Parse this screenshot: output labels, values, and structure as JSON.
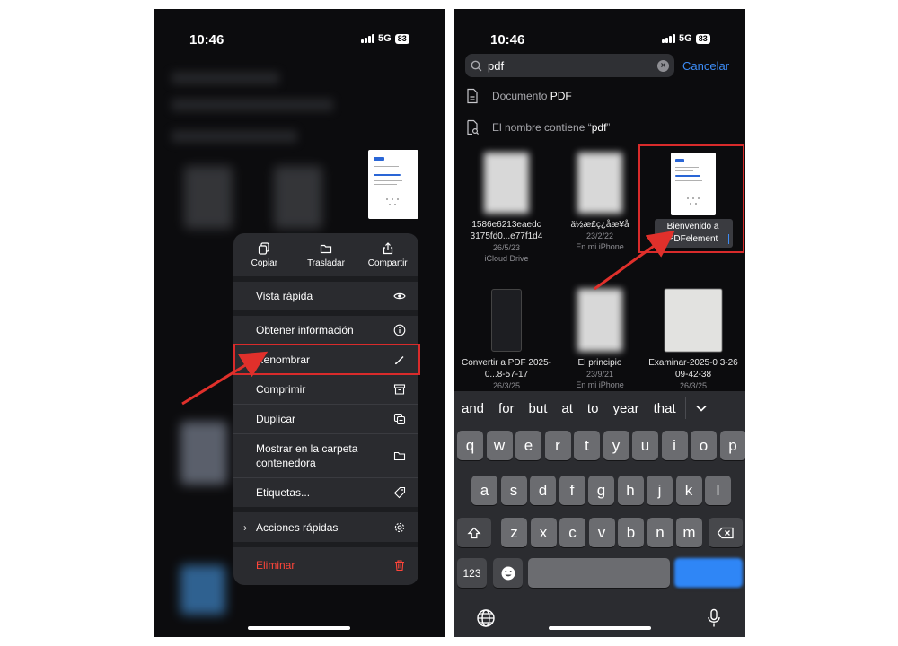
{
  "left_screen": {
    "status": {
      "time": "10:46",
      "network": "5G",
      "battery": "83"
    },
    "quick_actions": [
      {
        "label": "Copiar",
        "icon": "copy-icon"
      },
      {
        "label": "Trasladar",
        "icon": "folder-icon"
      },
      {
        "label": "Compartir",
        "icon": "share-icon"
      }
    ],
    "menu_items": [
      {
        "label": "Vista rápida",
        "icon": "eye-icon"
      },
      {
        "label": "Obtener información",
        "icon": "info-icon"
      },
      {
        "label": "Renombrar",
        "icon": "pencil-icon",
        "highlighted": true
      },
      {
        "label": "Comprimir",
        "icon": "archive-icon"
      },
      {
        "label": "Duplicar",
        "icon": "duplicate-icon"
      },
      {
        "label": "Mostrar en la carpeta contenedora",
        "icon": "folder-icon"
      },
      {
        "label": "Etiquetas...",
        "icon": "tag-icon"
      },
      {
        "label": "Acciones rápidas",
        "icon": "gear-icon",
        "has_submenu": true
      },
      {
        "label": "Eliminar",
        "icon": "trash-icon",
        "destructive": true
      }
    ]
  },
  "right_screen": {
    "status": {
      "time": "10:46",
      "network": "5G",
      "battery": "83"
    },
    "search": {
      "value": "pdf",
      "cancel_label": "Cancelar"
    },
    "suggestions": [
      {
        "prefix": "Documento ",
        "bold": "PDF",
        "suffix": "",
        "icon": "document-icon"
      },
      {
        "prefix": "El nombre contiene “",
        "bold": "pdf",
        "suffix": "”",
        "icon": "document-search-icon"
      }
    ],
    "files": [
      {
        "name": "1586e6213eaedc 3175fd0...e77f1d4",
        "date": "26/5/23",
        "location": "iCloud Drive"
      },
      {
        "name": "ä½æ£ç¿åæ¥å",
        "date": "23/2/22",
        "location": "En mi iPhone"
      },
      {
        "name": "Bienvenido a PDFelement",
        "date": "",
        "location": "",
        "renaming": true
      },
      {
        "name": "Convertir a PDF 2025-0...8-57-17",
        "date": "26/3/25",
        "location": ""
      },
      {
        "name": "El principio",
        "date": "23/9/21",
        "location": "En mi iPhone"
      },
      {
        "name": "Examinar-2025-0 3-26 09-42-38",
        "date": "26/3/25",
        "location": ""
      }
    ],
    "predictions": [
      "and",
      "for",
      "but",
      "at",
      "to",
      "year",
      "that"
    ],
    "keyboard": {
      "row1": [
        "q",
        "w",
        "e",
        "r",
        "t",
        "y",
        "u",
        "i",
        "o",
        "p"
      ],
      "row2": [
        "a",
        "s",
        "d",
        "f",
        "g",
        "h",
        "j",
        "k",
        "l"
      ],
      "row3": [
        "z",
        "x",
        "c",
        "v",
        "b",
        "n",
        "m"
      ],
      "numbers_key": "123"
    }
  },
  "colors": {
    "highlight_red": "#d92b2b",
    "ios_blue": "#3d8cf5",
    "destructive": "#ff453a"
  }
}
